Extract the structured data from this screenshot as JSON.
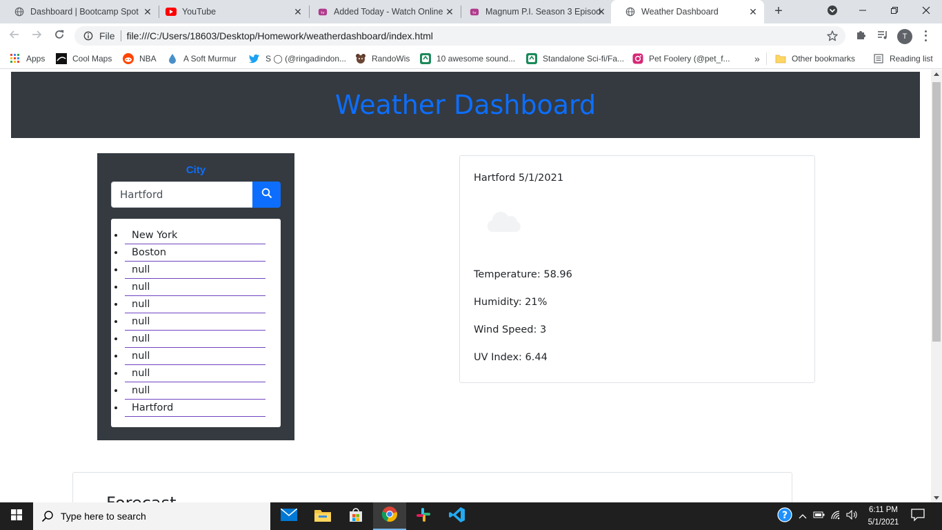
{
  "browser": {
    "tabs": [
      {
        "title": "Dashboard | Bootcamp Spot",
        "icon": "globe-icon"
      },
      {
        "title": "YouTube",
        "icon": "youtube-icon"
      },
      {
        "title": "Added Today - Watch Online",
        "icon": "tv-icon"
      },
      {
        "title": "Magnum P.I. Season 3 Episod",
        "icon": "tv-icon"
      },
      {
        "title": "Weather Dashboard",
        "icon": "globe-icon",
        "active": true
      }
    ],
    "scheme_label": "File",
    "url": "file:///C:/Users/18603/Desktop/Homework/weatherdashboard/index.html",
    "profile_initial": "T",
    "bookmarks": [
      {
        "label": "Apps",
        "icon": "apps-grid-icon"
      },
      {
        "label": "Cool Maps",
        "icon": "cool-maps-icon"
      },
      {
        "label": "NBA",
        "icon": "reddit-icon"
      },
      {
        "label": "A Soft Murmur",
        "icon": "droplet-icon"
      },
      {
        "label": "S ◯ (@ringadindon...",
        "icon": "twitter-icon"
      },
      {
        "label": "RandoWis",
        "icon": "bear-icon"
      },
      {
        "label": "10 awesome sound...",
        "icon": "bookmark-site-icon"
      },
      {
        "label": "Standalone Sci-fi/Fa...",
        "icon": "bookmark-site-icon"
      },
      {
        "label": "Pet Foolery (@pet_f...",
        "icon": "instagram-icon"
      }
    ],
    "overflow_label": "»",
    "other_bookmarks": "Other bookmarks",
    "reading_list": "Reading list",
    "accent": "#1a73e8"
  },
  "page": {
    "title": "Weather Dashboard",
    "search": {
      "label": "City",
      "value": "Hartford",
      "history": [
        "New York",
        "Boston",
        "null",
        "null",
        "null",
        "null",
        "null",
        "null",
        "null",
        "null",
        "Hartford"
      ]
    },
    "current": {
      "heading": "Hartford 5/1/2021",
      "icon": "cloud-icon",
      "temperature": "Temperature: 58.96",
      "humidity": "Humidity: 21%",
      "wind": "Wind Speed: 3",
      "uv": "UV Index: 6.44"
    },
    "forecast_title": "Forecast",
    "colors": {
      "header_bg": "#343a40",
      "title_blue": "#0d6efd",
      "list_underline": "#6f42c1"
    }
  },
  "taskbar": {
    "search_placeholder": "Type here to search",
    "time": "6:11 PM",
    "date": "5/1/2021"
  }
}
